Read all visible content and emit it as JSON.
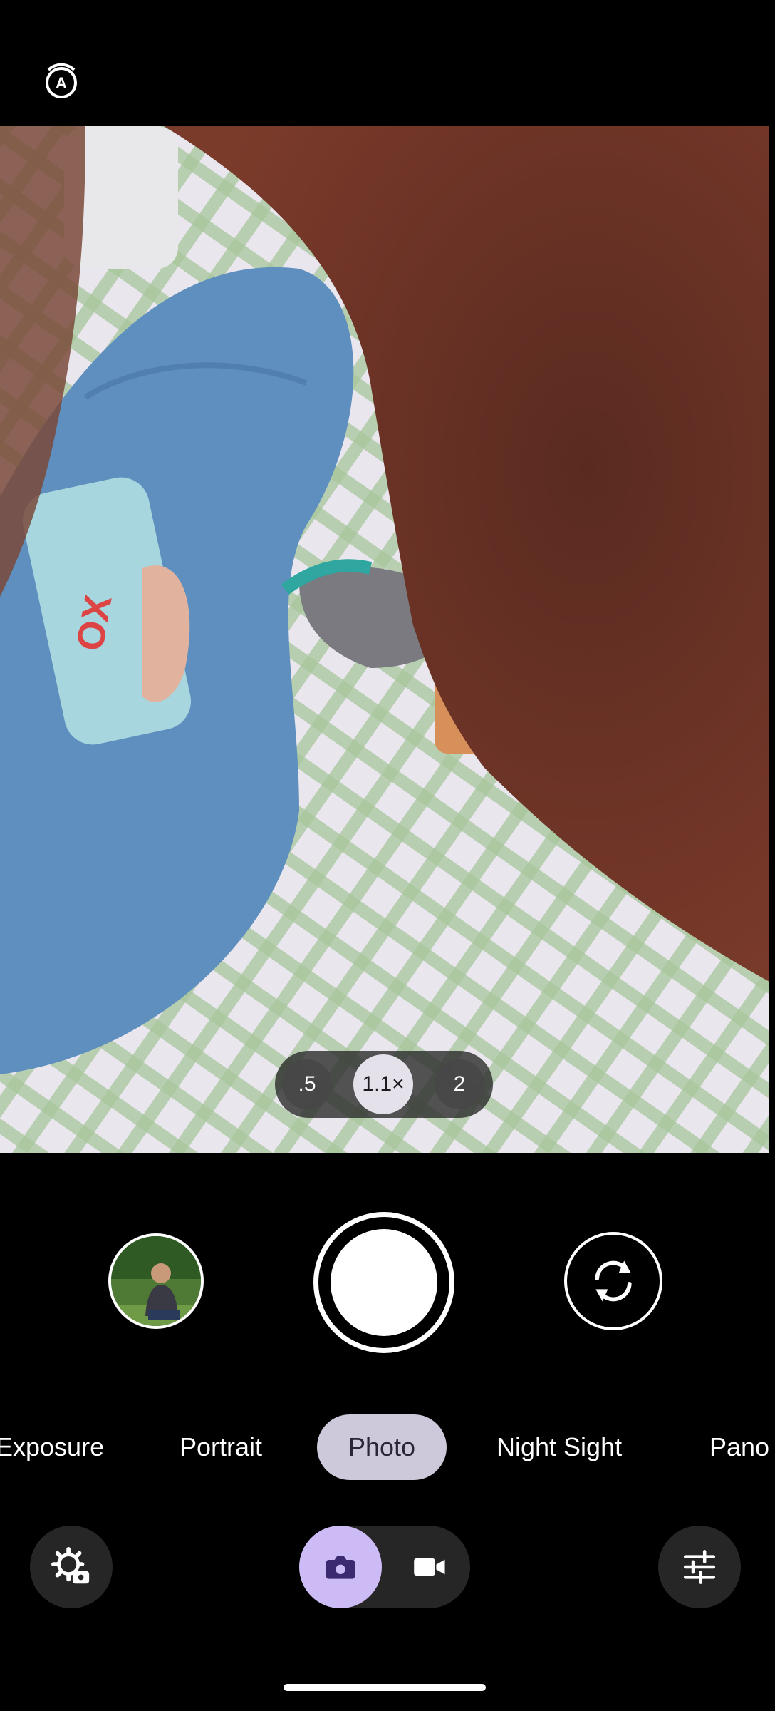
{
  "top_bar": {
    "auto_icon": "auto-mode-icon"
  },
  "zoom": {
    "options": [
      ".5",
      "1.1×",
      "2"
    ],
    "selected": "1.1×"
  },
  "capture": {
    "thumbnail_icon": "gallery-thumbnail",
    "shutter_icon": "shutter-button",
    "flip_icon": "flip-camera-icon"
  },
  "modes": {
    "items": [
      "Exposure",
      "Portrait",
      "Photo",
      "Night Sight",
      "Pano"
    ],
    "active": "Photo"
  },
  "bottom": {
    "settings_icon": "camera-settings-icon",
    "photo_icon": "camera-icon",
    "video_icon": "video-icon",
    "adjust_icon": "sliders-icon"
  },
  "colors": {
    "active_mode_bg": "#cdc8da",
    "photo_toggle_bg": "#cdbbf6",
    "control_bg": "#262626"
  }
}
